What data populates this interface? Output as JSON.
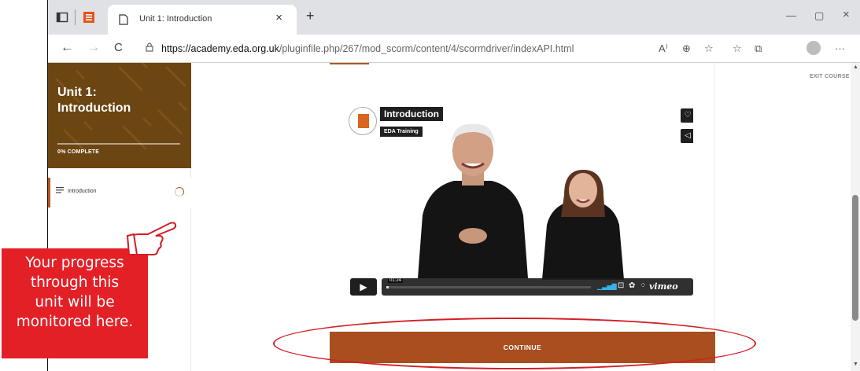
{
  "browser": {
    "tab_title": "Unit 1: Introduction",
    "tab_close": "×",
    "new_tab": "+",
    "url_host": "https://academy.eda.org.uk",
    "url_path": "/pluginfile.php/267/mod_scorm/content/4/scormdriver/indexAPI.html",
    "back": "←",
    "forward": "→",
    "reload": "C",
    "minimize": "—",
    "maximize": "▢",
    "close": "×",
    "more": "···",
    "read_aloud": "A⁾",
    "zoom": "⊕",
    "favorite": "☆",
    "favorites": "☆",
    "collections": "⧉"
  },
  "sidebar": {
    "title_line1": "Unit 1:",
    "title_line2": "Introduction",
    "progress_label": "0% COMPLETE",
    "progress_fraction": 0.0,
    "items": [
      {
        "label": "Introduction"
      }
    ]
  },
  "main": {
    "exit_label": "EXIT COURSE",
    "continue_label": "CONTINUE"
  },
  "video": {
    "title": "Introduction",
    "subtitle": "EDA Training",
    "time": "01:24",
    "progress_fraction": 0.01,
    "brand": "vimeo"
  },
  "annotation": {
    "callout_lines": [
      "Your progress",
      "through this",
      "unit will be",
      "monitored here."
    ]
  },
  "colors": {
    "accent": "#a84e1f",
    "sidebar_header": "#6b4512",
    "callout": "#e42027"
  }
}
